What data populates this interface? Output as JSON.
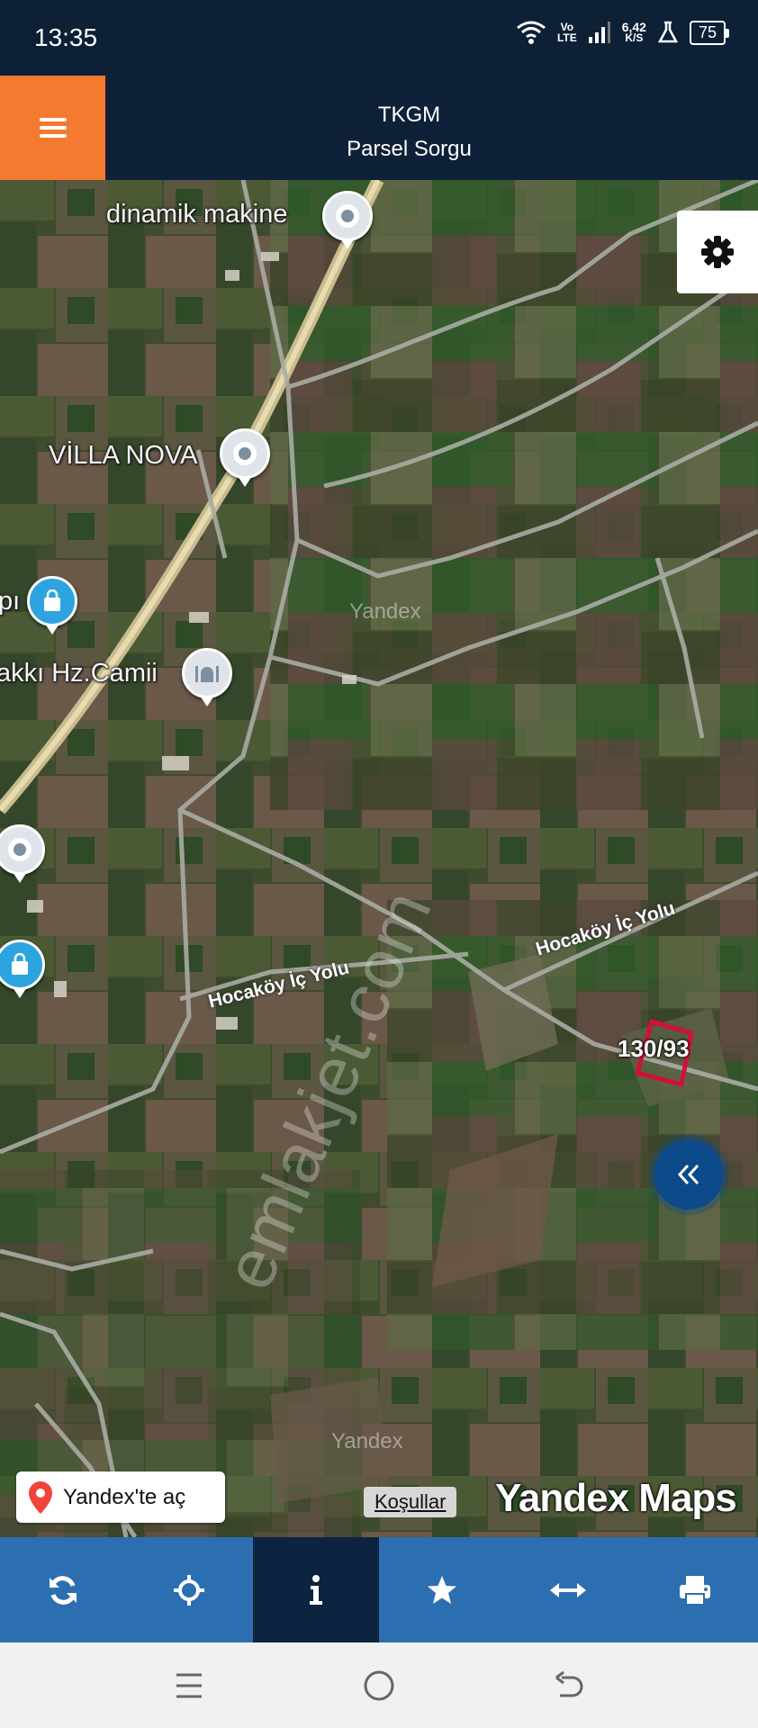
{
  "status_bar": {
    "time": "13:35",
    "network_top": "Vo",
    "network_bottom": "LTE",
    "speed_value": "6,42",
    "speed_unit": "K/S",
    "battery": "75"
  },
  "header": {
    "title": "TKGM",
    "subtitle": "Parsel Sorgu"
  },
  "map": {
    "pois": [
      {
        "label": "dinamik makine",
        "icon": "location-pin-icon"
      },
      {
        "label": "VİLLA NOVA",
        "icon": "location-pin-icon"
      },
      {
        "label": "pı",
        "icon": "shopping-bag-pin-icon"
      },
      {
        "label": "akkı Hz.Camii",
        "icon": "mosque-pin-icon"
      }
    ],
    "roads": [
      {
        "label": "Hocaköy İç Yolu"
      },
      {
        "label": "Hocaköy İç Yolu"
      }
    ],
    "parcel_label": "130/93",
    "parcel_color": "#d0103a",
    "watermark": "emlakjet.com",
    "provider_watermark": "Yandex",
    "open_in_yandex": "Yandex'te aç",
    "terms": "Koşullar",
    "brand": "Yandex Maps"
  },
  "toolbar": {
    "items": [
      {
        "icon": "refresh-icon",
        "active": false
      },
      {
        "icon": "locate-crosshair-icon",
        "active": false
      },
      {
        "icon": "info-icon",
        "active": true
      },
      {
        "icon": "star-icon",
        "active": false
      },
      {
        "icon": "measure-arrows-icon",
        "active": false
      },
      {
        "icon": "print-icon",
        "active": false
      }
    ],
    "background": "#2c6fb0",
    "active_background": "#0c2440"
  },
  "colors": {
    "menu_button": "#f47a2f",
    "header_bg": "#0e2138"
  }
}
